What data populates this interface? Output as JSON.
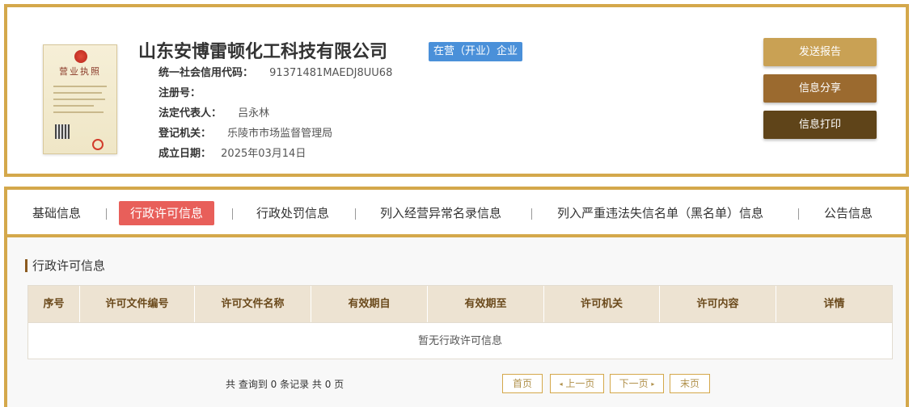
{
  "company": {
    "name": "山东安博雷顿化工科技有限公司",
    "status": "在营（开业）企业",
    "license_title": "营业执照",
    "fields": [
      {
        "label": "统一社会信用代码：",
        "value": "91371481MAEDJ8UU68"
      },
      {
        "label": "注册号：",
        "value": ""
      },
      {
        "label": "法定代表人：",
        "value": "吕永林"
      },
      {
        "label": "登记机关：",
        "value": "乐陵市市场监督管理局"
      },
      {
        "label": "成立日期：",
        "value": "2025年03月14日"
      }
    ]
  },
  "actions": {
    "send_report": "发送报告",
    "share": "信息分享",
    "print": "信息打印"
  },
  "tabs": [
    {
      "label": "基础信息"
    },
    {
      "label": "行政许可信息",
      "active": true
    },
    {
      "label": "行政处罚信息"
    },
    {
      "label": "列入经营异常名录信息"
    },
    {
      "label": "列入严重违法失信名单（黑名单）信息"
    },
    {
      "label": "公告信息"
    }
  ],
  "section": {
    "title": "行政许可信息",
    "columns": [
      "序号",
      "许可文件编号",
      "许可文件名称",
      "有效期自",
      "有效期至",
      "许可机关",
      "许可内容",
      "详情"
    ],
    "empty_text": "暂无行政许可信息"
  },
  "pagination": {
    "summary": "共 查询到 0 条记录 共 0 页",
    "first": "首页",
    "prev": "上一页",
    "next": "下一页",
    "last": "末页"
  },
  "colors": {
    "border_gold": "#d4a84b",
    "badge_blue": "#4a90d9",
    "tab_active": "#e85f5a"
  }
}
